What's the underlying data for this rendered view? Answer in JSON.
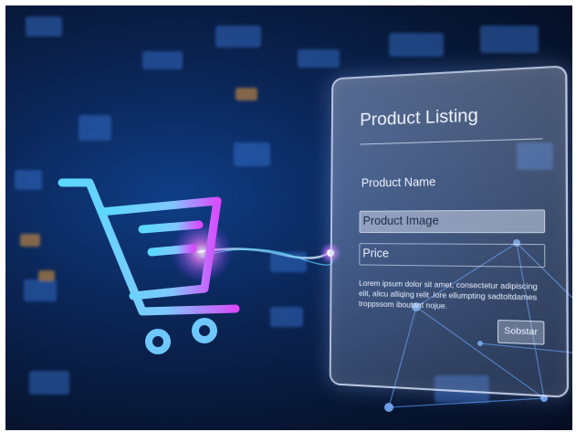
{
  "panel": {
    "title": "Product Listing",
    "fields": {
      "name": "Product Name",
      "image": "Product Image",
      "price": "Price"
    },
    "description": "Lorem ipsum dolor sit amet, consectetur adipiscing elit, alicu alliqing relit .lore ellumpting sadtoltdames troppssom iboutant nojue.",
    "submit_label": "Sobstar"
  },
  "colors": {
    "background": "#071633",
    "accent_cyan": "#5ad8ff",
    "accent_magenta": "#d94cff",
    "panel_border": "#dce6ff"
  },
  "icons": [
    "shopping-cart-icon"
  ]
}
